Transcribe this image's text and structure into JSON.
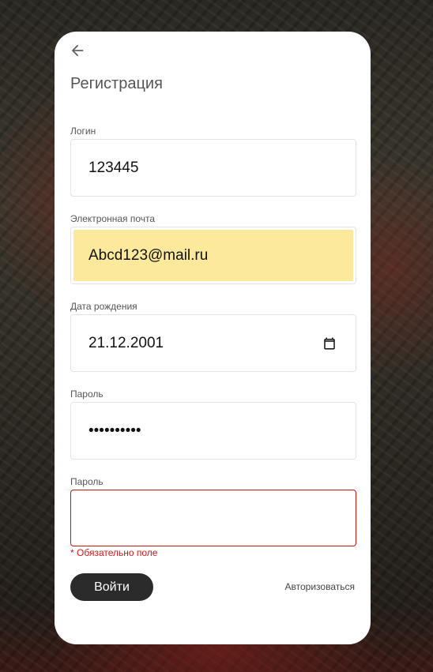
{
  "form": {
    "title": "Регистрация",
    "fields": [
      {
        "label": "Логин",
        "value": "123445"
      },
      {
        "label": "Электронная почта",
        "value": "Abcd123@mail.ru"
      },
      {
        "label": "Дата рождения",
        "value": "21.12.2001"
      },
      {
        "label": "Пароль",
        "value": "••••••••••"
      },
      {
        "label": "Пароль",
        "value": ""
      }
    ],
    "error_message": "* Обязательно поле",
    "submit_label": "Войти",
    "login_link": "Авторизоваться"
  },
  "colors": {
    "card_bg": "#ffffff",
    "autofill_bg": "#fde99b",
    "error": "#cc1111",
    "button_bg": "#2b2b2b"
  },
  "icons": [
    "arrow-left-icon",
    "calendar-icon"
  ]
}
